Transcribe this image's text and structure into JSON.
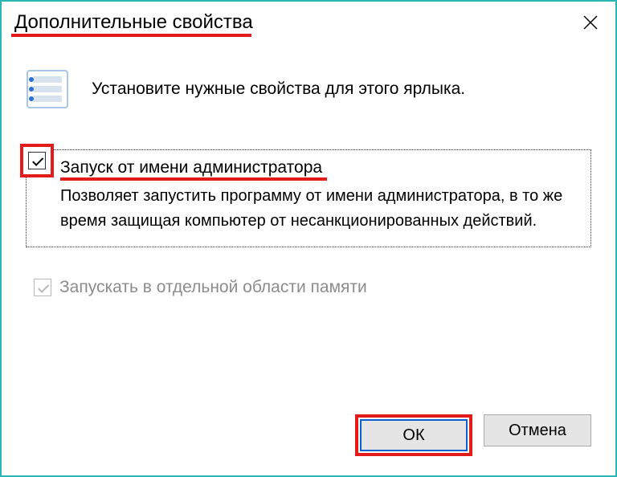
{
  "window": {
    "title": "Дополнительные свойства"
  },
  "intro": {
    "text": "Установите нужные свойства для этого ярлыка."
  },
  "option1": {
    "label": "Запуск от имени администратора",
    "description": "Позволяет запустить программу от имени администратора, в то же время защищая компьютер от несанкционированных действий.",
    "checked": true
  },
  "option2": {
    "label": "Запускать в отдельной области памяти",
    "checked": true,
    "disabled": true
  },
  "buttons": {
    "ok": "ОК",
    "cancel": "Отмена"
  }
}
